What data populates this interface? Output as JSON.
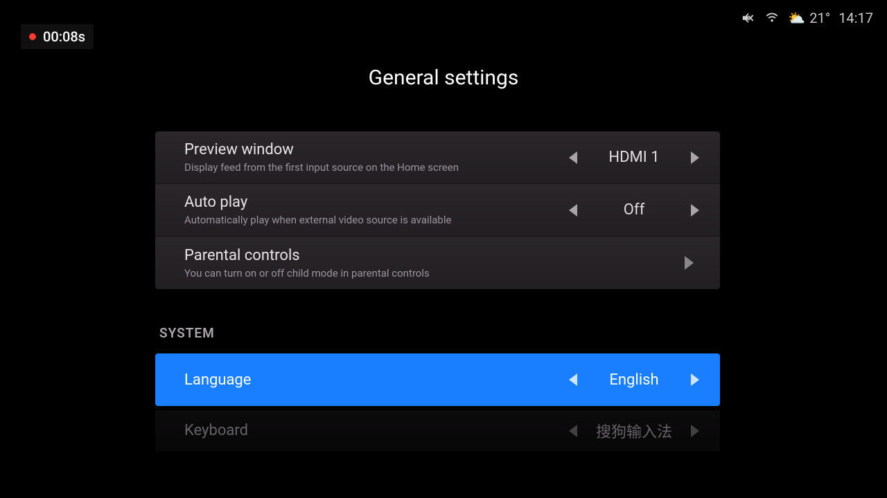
{
  "recording": {
    "time": "00:08s"
  },
  "status": {
    "temperature": "21°",
    "clock": "14:17"
  },
  "page": {
    "title": "General settings"
  },
  "rows": {
    "preview": {
      "title": "Preview window",
      "sub": "Display feed from the first input source on the Home screen",
      "value": "HDMI 1"
    },
    "autoplay": {
      "title": "Auto play",
      "sub": "Automatically play when external video source is available",
      "value": "Off"
    },
    "parental": {
      "title": "Parental controls",
      "sub": "You can turn on or off child mode in parental controls"
    },
    "language": {
      "title": "Language",
      "value": "English"
    },
    "keyboard": {
      "title": "Keyboard",
      "value": "搜狗输入法"
    }
  },
  "sections": {
    "system": "SYSTEM"
  }
}
